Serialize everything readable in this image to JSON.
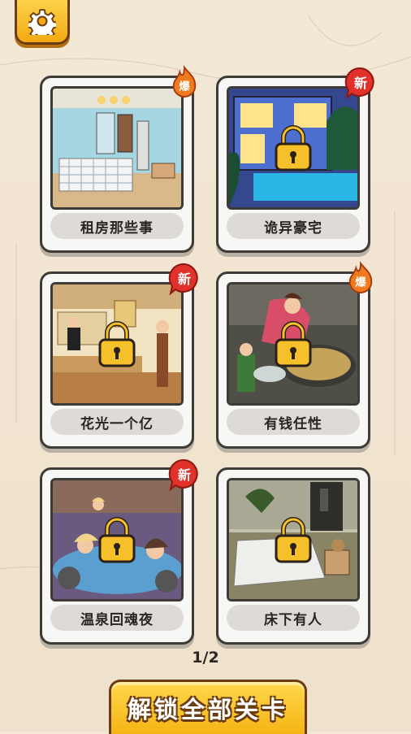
{
  "settings": {
    "icon": "gear-icon"
  },
  "levels": [
    {
      "title": "租房那些事",
      "badge": "爆",
      "badge_type": "hot",
      "locked": false,
      "scene": "bedroom-apartment"
    },
    {
      "title": "诡异豪宅",
      "badge": "新",
      "badge_type": "new",
      "locked": true,
      "scene": "mansion-night"
    },
    {
      "title": "花光一个亿",
      "badge": "新",
      "badge_type": "new",
      "locked": true,
      "scene": "shop-counter"
    },
    {
      "title": "有钱任性",
      "badge": "爆",
      "badge_type": "hot",
      "locked": true,
      "scene": "rich-lady-dining"
    },
    {
      "title": "温泉回魂夜",
      "badge": "新",
      "badge_type": "new",
      "locked": true,
      "scene": "hot-spring"
    },
    {
      "title": "床下有人",
      "badge": "",
      "badge_type": "",
      "locked": true,
      "scene": "bedroom-dark"
    }
  ],
  "pagination": {
    "text": "1/2"
  },
  "unlock_all_label": "解锁全部关卡",
  "colors": {
    "button_yellow": "#f5b414",
    "badge_red": "#e0322b",
    "outline": "#3e3a36"
  }
}
